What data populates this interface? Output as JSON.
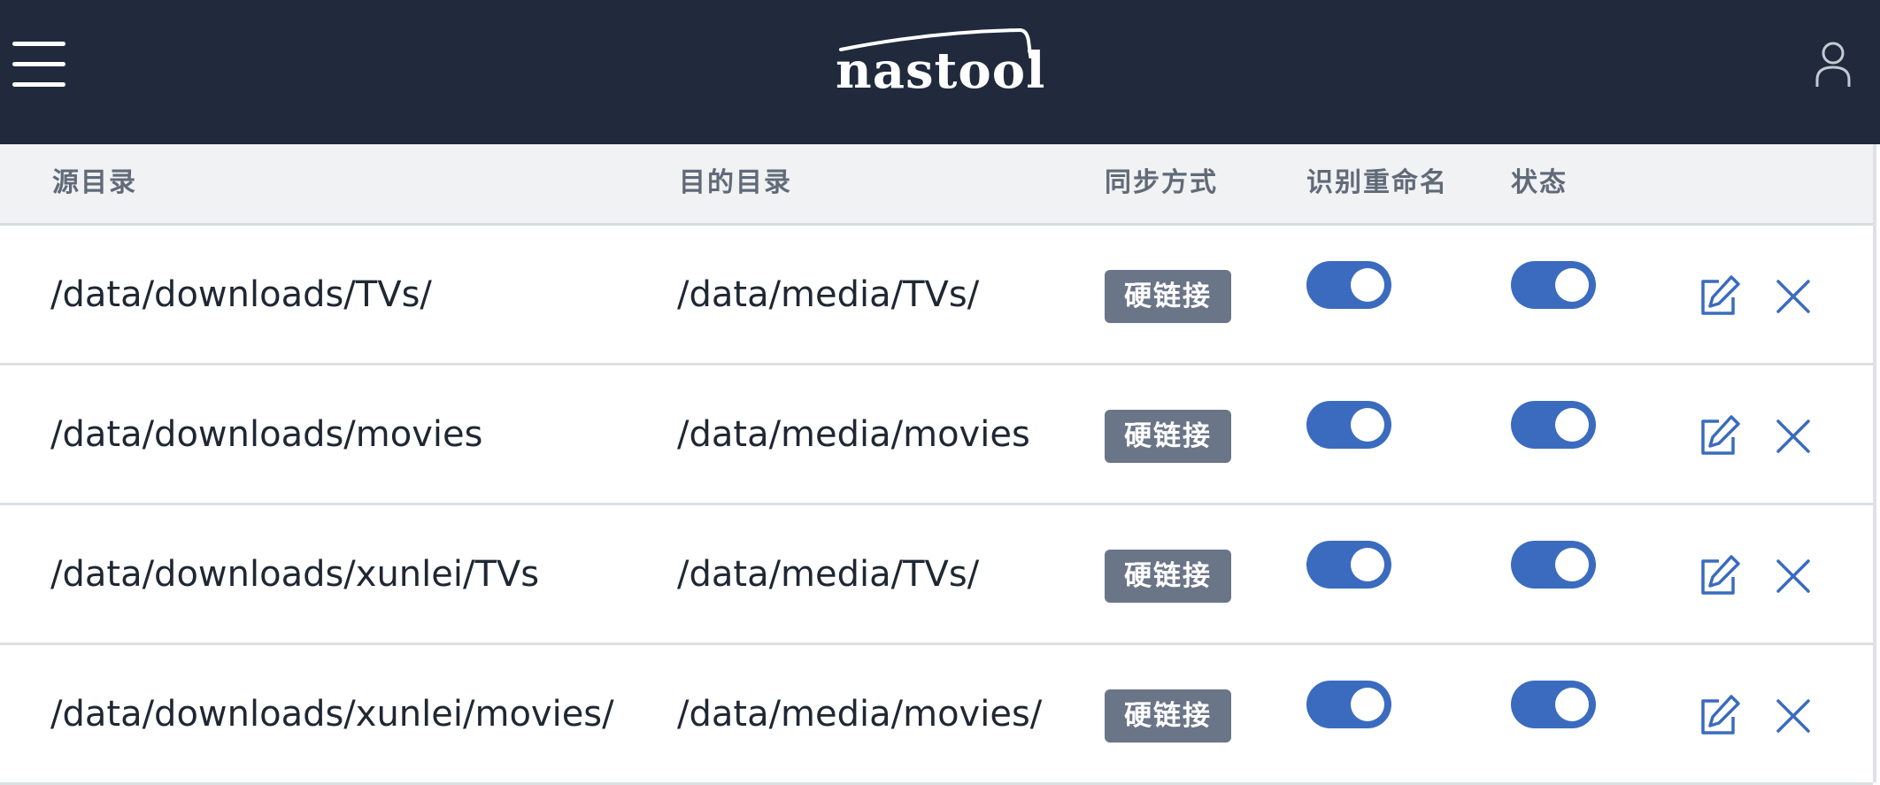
{
  "header": {
    "menu_icon": "hamburger-menu-icon",
    "logo_text": "nastool",
    "user_icon": "user-icon"
  },
  "table": {
    "columns": [
      "源目录",
      "目的目录",
      "同步方式",
      "识别重命名",
      "状态"
    ],
    "rows": [
      {
        "source": "/data/downloads/TVs/",
        "target": "/data/media/TVs/",
        "sync_mode": "硬链接",
        "rename": true,
        "enabled": true
      },
      {
        "source": "/data/downloads/movies",
        "target": "/data/media/movies",
        "sync_mode": "硬链接",
        "rename": true,
        "enabled": true
      },
      {
        "source": "/data/downloads/xunlei/TVs",
        "target": "/data/media/TVs/",
        "sync_mode": "硬链接",
        "rename": true,
        "enabled": true
      },
      {
        "source": "/data/downloads/xunlei/movies/",
        "target": "/data/media/movies/",
        "sync_mode": "硬链接",
        "rename": true,
        "enabled": true
      }
    ],
    "row_actions": [
      "edit-icon",
      "close-icon"
    ]
  },
  "colors": {
    "header_bg": "#202a3c",
    "accent": "#3a6bbf",
    "badge_bg": "#6b7588"
  }
}
